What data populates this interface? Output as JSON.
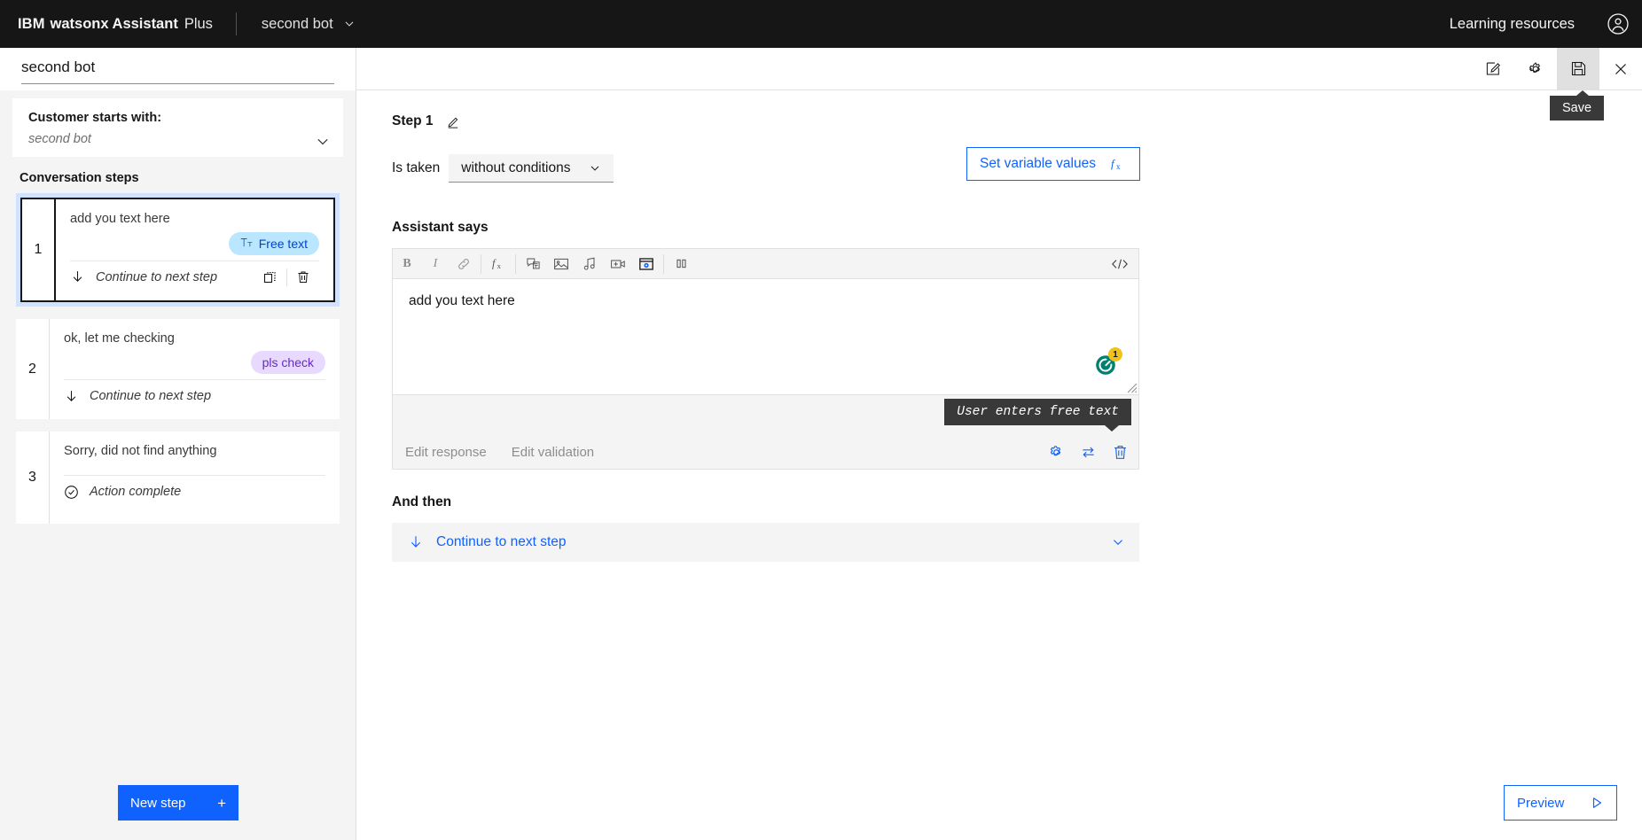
{
  "topnav": {
    "brand_ibm": "IBM",
    "brand_product": "watsonx Assistant",
    "brand_plan": "Plus",
    "bot_name": "second bot",
    "learning_resources": "Learning resources",
    "chevron_icon": "chevron-down-icon",
    "avatar_icon": "user-avatar-icon"
  },
  "left_panel": {
    "action_title_value": "second bot",
    "action_title_placeholder": "Action name",
    "starts_with": {
      "label": "Customer starts with:",
      "value": "second bot",
      "chevron_icon": "chevron-down-icon"
    },
    "steps_header": "Conversation steps",
    "steps": [
      {
        "number": "1",
        "text": "add you text here",
        "tag": "Free text",
        "tag_icon": "free-text-icon",
        "footer_label": "Continue to next step",
        "footer_icon": "arrow-down-icon",
        "duplicate_icon": "duplicate-icon",
        "delete_icon": "trash-icon",
        "selected": true
      },
      {
        "number": "2",
        "text": "ok, let me checking",
        "tag": "pls check",
        "footer_label": "Continue to next step",
        "footer_icon": "arrow-down-icon",
        "selected": false
      },
      {
        "number": "3",
        "text": "Sorry, did not find anything",
        "footer_label": "Action complete",
        "footer_icon": "checkmark-outline-icon",
        "selected": false
      }
    ],
    "new_step_label": "New step",
    "new_step_icon": "plus-icon"
  },
  "right_header": {
    "edit_icon": "edit-pencil-icon",
    "settings_icon": "gear-icon",
    "save_icon": "save-floppy-icon",
    "close_icon": "close-x-icon",
    "save_tooltip": "Save"
  },
  "main": {
    "step_title": "Step 1",
    "step_edit_icon": "pencil-icon",
    "condition": {
      "label": "Is taken",
      "value": "without conditions",
      "chevron_icon": "chevron-down-icon"
    },
    "set_variable_values": {
      "label": "Set variable values",
      "icon": "fx-icon"
    },
    "assistant_says_label": "Assistant says",
    "editor": {
      "toolbar": [
        {
          "name": "bold-icon",
          "glyph": "B"
        },
        {
          "name": "italic-icon",
          "glyph": "I"
        },
        {
          "name": "link-icon",
          "glyph": "link"
        },
        {
          "name": "fx-icon",
          "glyph": "fx"
        },
        {
          "name": "json-response-icon",
          "glyph": "json"
        },
        {
          "name": "image-icon",
          "glyph": "image"
        },
        {
          "name": "audio-icon",
          "glyph": "audio"
        },
        {
          "name": "video-icon",
          "glyph": "video"
        },
        {
          "name": "iframe-icon",
          "glyph": "iframe"
        },
        {
          "name": "pause-icon",
          "glyph": "pause"
        }
      ],
      "code_view_icon": "code-view-icon",
      "body_text": "add you text here",
      "assistant_badge_count": "1",
      "assistant_badge_icon": "watsonx-assistant-icon"
    },
    "free_text_tooltip": "User enters free text",
    "editor_footer": {
      "edit_response": "Edit response",
      "edit_validation": "Edit validation",
      "settings_icon": "gear-icon",
      "repeat_icon": "repeat-icon",
      "delete_icon": "trash-icon"
    },
    "and_then_label": "And then",
    "and_then": {
      "icon": "arrow-down-icon",
      "label": "Continue to next step",
      "chevron_icon": "chevron-down-icon"
    },
    "preview": {
      "label": "Preview",
      "icon": "play-triangle-icon"
    }
  },
  "colors": {
    "brand_blue": "#0f62fe",
    "nav_black": "#161616",
    "tag_freetext_bg": "#bae6ff",
    "tag_freetext_fg": "#0043ce",
    "tag_plscheck_bg": "#e8daff",
    "tag_plscheck_fg": "#6929c4",
    "selected_step_bg": "#d0e2ff",
    "badge_amber": "#f1c21b",
    "assistant_teal": "#00806f"
  }
}
